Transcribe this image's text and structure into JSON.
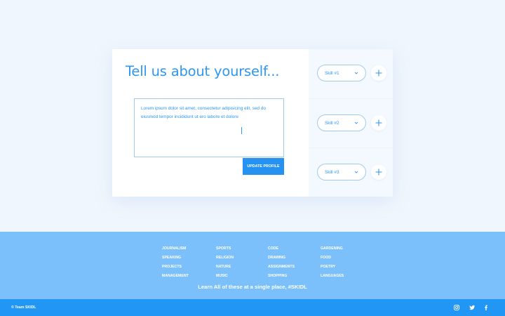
{
  "profile": {
    "title": "Tell us about yourself...",
    "bio_text": "Lorem ipsum dolor sit amet, consectetur adipisicing elit, sed do eiusmod tempor incididunt ut ero labore et dolore",
    "update_label": "UPDATE PROFILE"
  },
  "skills": [
    {
      "label": "Skill #1",
      "chevron_icon": "chevron-down-icon",
      "add_icon": "plus-icon"
    },
    {
      "label": "Skill #2",
      "chevron_icon": "chevron-down-icon",
      "add_icon": "plus-icon"
    },
    {
      "label": "Skill #3",
      "chevron_icon": "chevron-down-icon",
      "add_icon": "plus-icon"
    }
  ],
  "footer": {
    "categories": [
      [
        "JOURNALISM",
        "SPEAKING",
        "PROJECTS",
        "MANAGEMENT"
      ],
      [
        "SPORTS",
        "RELIGION",
        "NATURE",
        "MUSIC"
      ],
      [
        "CODE",
        "DRAWING",
        "ASSIGNMENTS",
        "SHOPPING"
      ],
      [
        "GARDENING",
        "FOOD",
        "POETRY",
        "LANGUAGES"
      ]
    ],
    "tagline": "Learn All of these at a single place, #SKIDL",
    "copyright": "© Team SKIDL",
    "social_icons": [
      "instagram-icon",
      "twitter-icon",
      "facebook-icon"
    ]
  },
  "colors": {
    "accent": "#2e97f0",
    "footer_bg": "#7cc0fb",
    "bottombar_bg": "#2196f5",
    "page_bg": "#f0f6fd"
  }
}
